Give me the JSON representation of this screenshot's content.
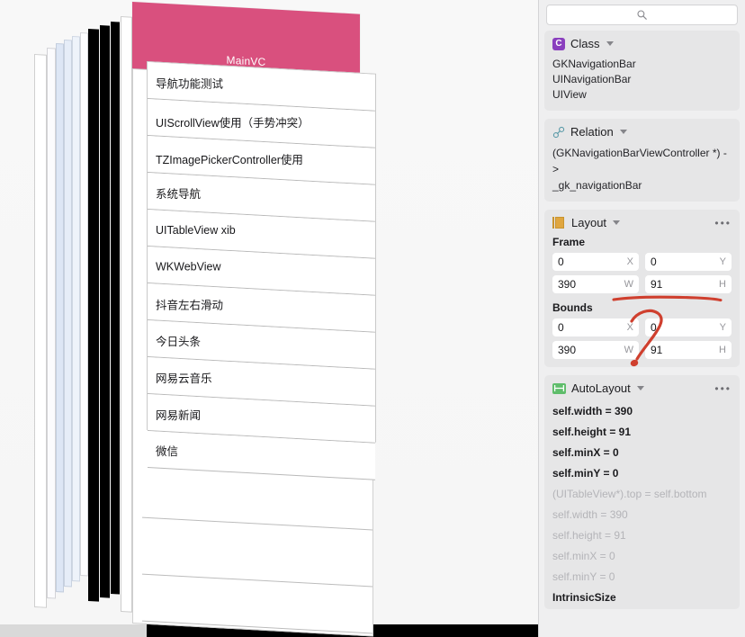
{
  "canvas": {
    "name": "view-debugger-3d-canvas",
    "view_controller_label": "MainVC",
    "navbar_color": "#d9507e",
    "table_rows": [
      "导航功能测试",
      "UIScrollView使用（手势冲突）",
      "TZImagePickerController使用",
      "系统导航",
      "UITableView xib",
      "WKWebView",
      "抖音左右滑动",
      "今日头条",
      "网易云音乐",
      "网易新闻",
      "微信"
    ]
  },
  "sidebar": {
    "search": {
      "value": "",
      "placeholder": "",
      "icon": "search-icon"
    },
    "class_panel": {
      "icon": "class-badge-icon",
      "icon_letter": "C",
      "title": "Class",
      "accent": "#8a3fbe",
      "items": [
        "GKNavigationBar",
        "UINavigationBar",
        "UIView"
      ]
    },
    "relation_panel": {
      "icon": "link-icon",
      "title": "Relation",
      "accent": "#5a9aa8",
      "lines": [
        "(GKNavigationBarViewController *) ->",
        "_gk_navigationBar"
      ]
    },
    "layout_panel": {
      "icon": "layout-icon",
      "title": "Layout",
      "accent": "#e0a63f",
      "more_label": "•••",
      "frame_label": "Frame",
      "bounds_label": "Bounds",
      "frame": {
        "x": "0",
        "x_unit": "X",
        "y": "0",
        "y_unit": "Y",
        "w": "390",
        "w_unit": "W",
        "h": "91",
        "h_unit": "H"
      },
      "bounds": {
        "x": "0",
        "x_unit": "X",
        "y": "0",
        "y_unit": "Y",
        "w": "390",
        "w_unit": "W",
        "h": "91",
        "h_unit": "H"
      }
    },
    "autolayout_panel": {
      "icon": "autolayout-icon",
      "title": "AutoLayout",
      "accent": "#5fbd6b",
      "more_label": "•••",
      "constraints": [
        {
          "text": "self.width = 390",
          "dim": false
        },
        {
          "text": "self.height = 91",
          "dim": false
        },
        {
          "text": "self.minX = 0",
          "dim": false
        },
        {
          "text": "self.minY = 0",
          "dim": false
        },
        {
          "text": "(UITableView*).top = self.bottom",
          "dim": true
        },
        {
          "text": "self.width = 390",
          "dim": true
        },
        {
          "text": "self.height = 91",
          "dim": true
        },
        {
          "text": "self.minX = 0",
          "dim": true
        },
        {
          "text": "self.minY = 0",
          "dim": true
        }
      ],
      "intrinsic_size_label": "IntrinsicSize"
    }
  },
  "annotation": {
    "name": "red-ink-question-mark",
    "color": "#cf3f2e",
    "marks": [
      "underline-stroke",
      "question-mark"
    ]
  }
}
